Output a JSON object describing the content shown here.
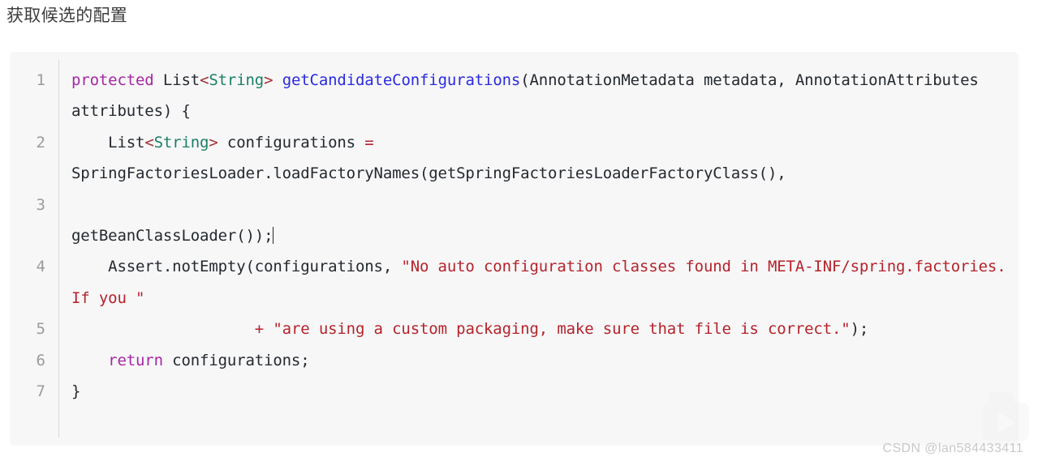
{
  "page": {
    "title": "获取候选的配置",
    "background_color": "#ffffff"
  },
  "code_block": {
    "language": "java",
    "background_color": "#f7f7f8",
    "gutter_color": "#9b9b9f",
    "colors": {
      "keyword": "#a626a4",
      "type": "#1a7f64",
      "function": "#2a2ae0",
      "punctuation": "#a03030",
      "string": "#b5232a",
      "plain": "#24292e"
    },
    "lines": [
      {
        "number": "1",
        "text": "protected List<String> getCandidateConfigurations(AnnotationMetadata metadata, AnnotationAttributes attributes) {"
      },
      {
        "number": "2",
        "text": "    List<String> configurations = SpringFactoriesLoader.loadFactoryNames(getSpringFactoriesLoaderFactoryClass(),"
      },
      {
        "number": "3",
        "text": "            getBeanClassLoader());"
      },
      {
        "number": "4",
        "text": "    Assert.notEmpty(configurations, \"No auto configuration classes found in META-INF/spring.factories. If you \""
      },
      {
        "number": "5",
        "text": "                    + \"are using a custom packaging, make sure that file is correct.\");"
      },
      {
        "number": "6",
        "text": "    return configurations;"
      },
      {
        "number": "7",
        "text": "}"
      }
    ]
  },
  "watermark": {
    "text": "CSDN @lan584433411",
    "color": "#c9c9cd"
  }
}
